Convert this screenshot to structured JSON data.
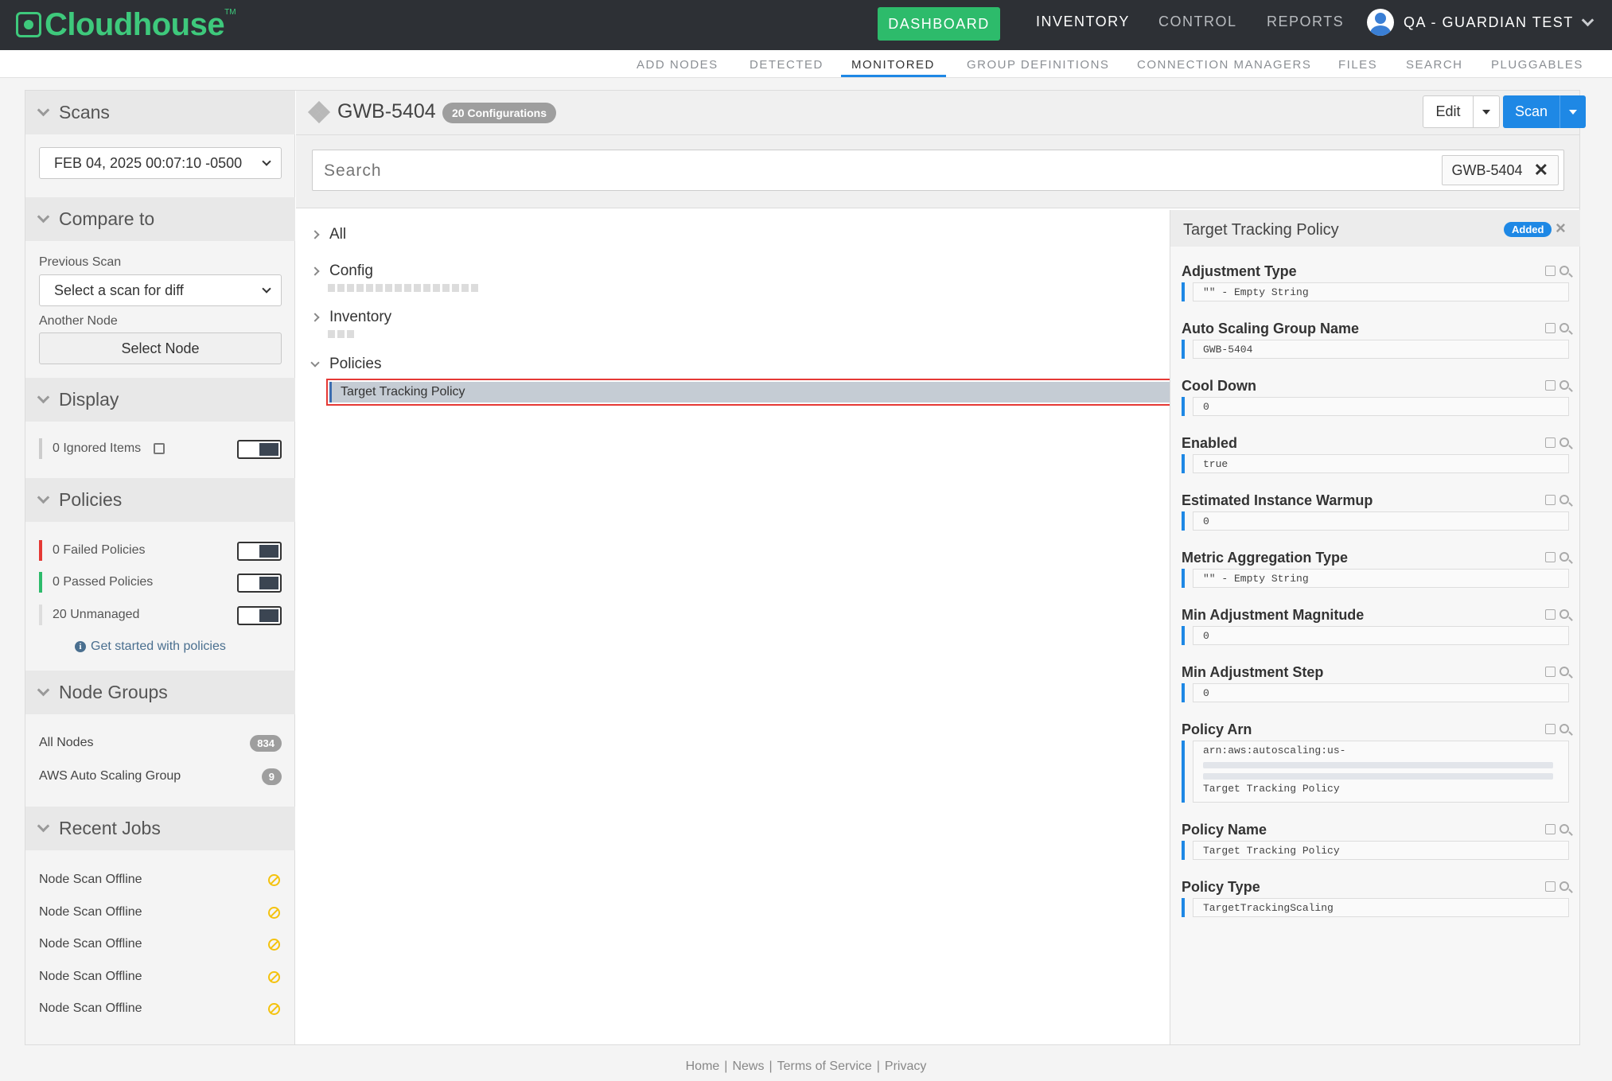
{
  "brand": {
    "name": "Cloudhouse",
    "tm": "TM"
  },
  "nav": {
    "dashboard": "DASHBOARD",
    "inventory": "INVENTORY",
    "control": "CONTROL",
    "reports": "REPORTS",
    "user": "QA - GUARDIAN TEST"
  },
  "subnav": [
    "ADD NODES",
    "DETECTED",
    "MONITORED",
    "GROUP DEFINITIONS",
    "CONNECTION MANAGERS",
    "FILES",
    "SEARCH",
    "PLUGGABLES"
  ],
  "sidebar": {
    "scans": {
      "title": "Scans",
      "selected": "FEB 04, 2025 00:07:10 -0500"
    },
    "compare": {
      "title": "Compare to",
      "previous_label": "Previous Scan",
      "previous_value": "Select a scan for diff",
      "another_label": "Another Node",
      "select_node": "Select Node"
    },
    "display": {
      "title": "Display",
      "ignored": "0 Ignored Items"
    },
    "policies": {
      "title": "Policies",
      "failed": "0 Failed Policies",
      "passed": "0 Passed Policies",
      "unmanaged": "20 Unmanaged",
      "help": "Get started with policies"
    },
    "node_groups": {
      "title": "Node Groups",
      "items": [
        {
          "label": "All Nodes",
          "count": "834"
        },
        {
          "label": "AWS Auto Scaling Group",
          "count": "9"
        }
      ]
    },
    "recent_jobs": {
      "title": "Recent Jobs",
      "items": [
        "Node Scan Offline",
        "Node Scan Offline",
        "Node Scan Offline",
        "Node Scan Offline",
        "Node Scan Offline"
      ]
    }
  },
  "header": {
    "node": "GWB-5404",
    "configs": "20 Configurations",
    "edit": "Edit",
    "scan": "Scan"
  },
  "search": {
    "placeholder": "Search",
    "tag": "GWB-5404"
  },
  "tree": {
    "all": "All",
    "config": "Config",
    "inventory": "Inventory",
    "policies": "Policies",
    "selected_item": "Target Tracking Policy"
  },
  "detail": {
    "title": "Target Tracking Policy",
    "badge": "Added",
    "props": [
      {
        "name": "Adjustment Type",
        "value": "\"\" - Empty String"
      },
      {
        "name": "Auto Scaling Group Name",
        "value": "GWB-5404"
      },
      {
        "name": "Cool Down",
        "value": "0"
      },
      {
        "name": "Enabled",
        "value": "true"
      },
      {
        "name": "Estimated Instance Warmup",
        "value": "0"
      },
      {
        "name": "Metric Aggregation Type",
        "value": "\"\" - Empty String"
      },
      {
        "name": "Min Adjustment Magnitude",
        "value": "0"
      },
      {
        "name": "Min Adjustment Step",
        "value": "0"
      },
      {
        "name": "Policy Arn",
        "value": "arn:aws:autoscaling:us-",
        "value_end": "Target Tracking Policy"
      },
      {
        "name": "Policy Name",
        "value": "Target Tracking Policy"
      },
      {
        "name": "Policy Type",
        "value": "TargetTrackingScaling"
      }
    ]
  },
  "footer": {
    "home": "Home",
    "news": "News",
    "terms": "Terms of Service",
    "privacy": "Privacy"
  },
  "colors": {
    "brand_green": "#3ec97c",
    "accent_blue": "#1e88e5",
    "failed": "#e53935",
    "passed": "#2dbb6b",
    "warn": "#f4c20d"
  }
}
